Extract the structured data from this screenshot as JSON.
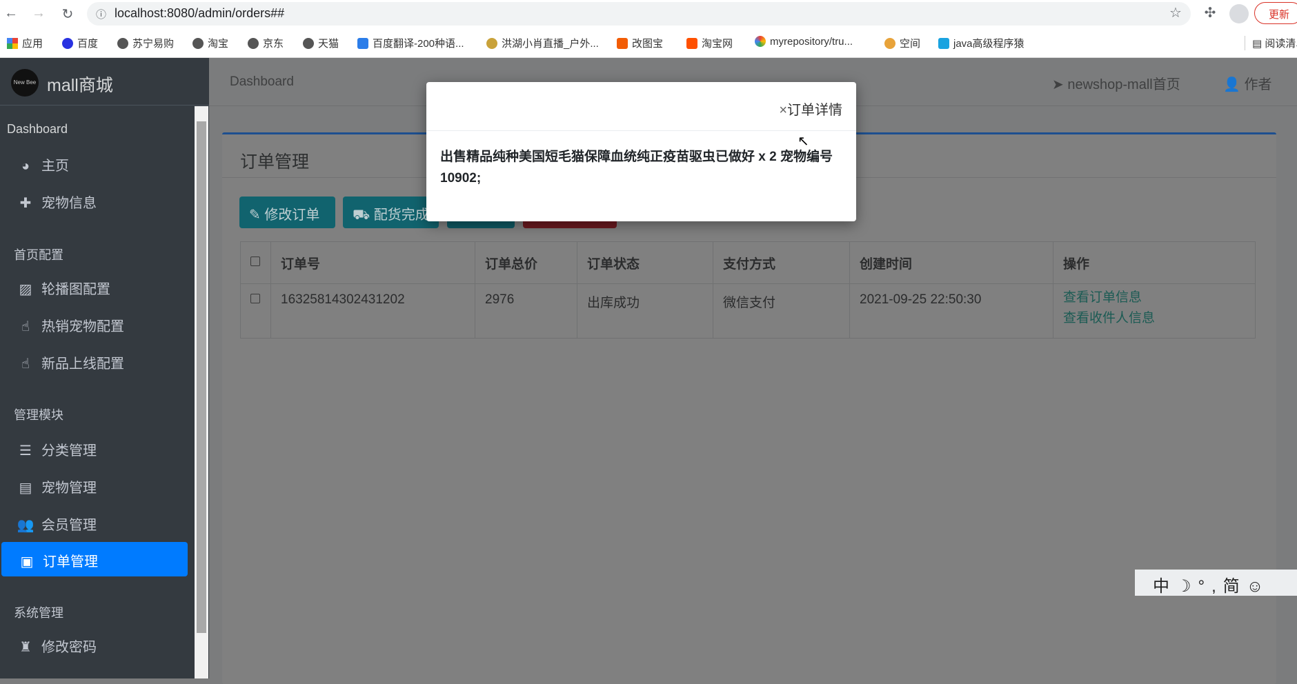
{
  "browser": {
    "url": "localhost:8080/admin/orders##",
    "update_label": "更新",
    "bookmarks": [
      "应用",
      "百度",
      "苏宁易购",
      "淘宝",
      "京东",
      "天猫",
      "百度翻译-200种语...",
      "洪湖小肖直播_户外...",
      "改图宝",
      "淘宝网",
      "myrepository/tru...",
      "空间",
      "java高级程序猿"
    ],
    "reading_list": "阅读清单"
  },
  "sidebar": {
    "brand": "mall商城",
    "logo_text": "New Bee",
    "sections": [
      {
        "label": "Dashboard",
        "items": [
          {
            "label": "主页",
            "icon": "dashboard-icon"
          },
          {
            "label": "宠物信息",
            "icon": "plus-icon"
          }
        ]
      },
      {
        "label": "首页配置",
        "items": [
          {
            "label": "轮播图配置",
            "icon": "image-icon"
          },
          {
            "label": "热销宠物配置",
            "icon": "hand-icon"
          },
          {
            "label": "新品上线配置",
            "icon": "hand-icon"
          }
        ]
      },
      {
        "label": "管理模块",
        "items": [
          {
            "label": "分类管理",
            "icon": "list-icon"
          },
          {
            "label": "宠物管理",
            "icon": "archive-icon"
          },
          {
            "label": "会员管理",
            "icon": "users-icon"
          },
          {
            "label": "订单管理",
            "icon": "money-icon",
            "active": true
          }
        ]
      },
      {
        "label": "系统管理",
        "items": [
          {
            "label": "修改密码",
            "icon": "user-secret-icon"
          }
        ]
      }
    ]
  },
  "header": {
    "breadcrumb": "Dashboard",
    "home_link": "newshop-mall首页",
    "author_link": "作者"
  },
  "card": {
    "title": "订单管理",
    "buttons": [
      "修改订单",
      "配货完成"
    ],
    "table": {
      "headers": [
        "订单号",
        "订单总价",
        "订单状态",
        "支付方式",
        "创建时间",
        "操作"
      ],
      "rows": [
        {
          "order_no": "16325814302431202",
          "total": "2976",
          "status": "出库成功",
          "payment": "微信支付",
          "created": "2021-09-25 22:50:30",
          "actions": [
            "查看订单信息",
            "查看收件人信息"
          ]
        }
      ]
    }
  },
  "modal": {
    "close": "×",
    "title": "订单详情",
    "body": "出售精品纯种美国短毛猫保障血统纯正疫苗驱虫已做好 x 2 宠物编号 10902;"
  },
  "ime": {
    "items": [
      "中",
      "☽",
      "°,",
      "简",
      "☺"
    ]
  }
}
